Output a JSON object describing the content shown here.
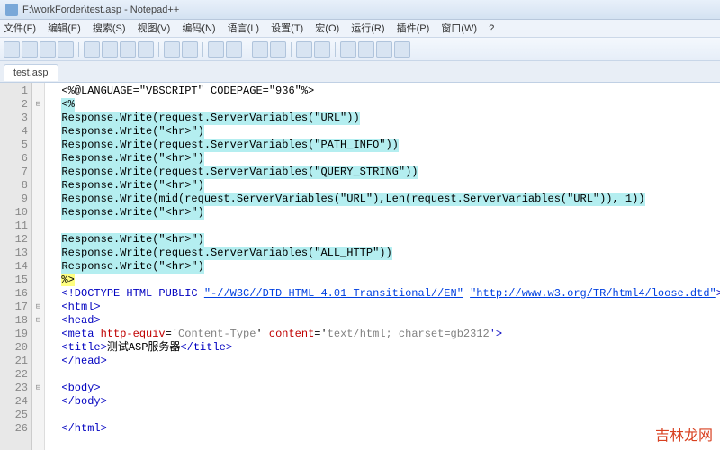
{
  "window": {
    "title": "F:\\workForder\\test.asp - Notepad++"
  },
  "menu": [
    "文件(F)",
    "编辑(E)",
    "搜索(S)",
    "视图(V)",
    "编码(N)",
    "语言(L)",
    "设置(T)",
    "宏(O)",
    "运行(R)",
    "插件(P)",
    "窗口(W)",
    "?"
  ],
  "tab": {
    "label": "test.asp"
  },
  "watermark": "吉林龙网",
  "code": {
    "lines": [
      {
        "n": "1",
        "fold": "",
        "hl": "none",
        "text": "<%@LANGUAGE=\"VBSCRIPT\" CODEPAGE=\"936\"%>"
      },
      {
        "n": "2",
        "fold": "⊟",
        "hl": "blue",
        "text": "<%"
      },
      {
        "n": "3",
        "fold": "",
        "hl": "blue",
        "text": "Response.Write(request.ServerVariables(\"URL\"))"
      },
      {
        "n": "4",
        "fold": "",
        "hl": "blue",
        "text": "Response.Write(\"<hr>\")"
      },
      {
        "n": "5",
        "fold": "",
        "hl": "blue",
        "text": "Response.Write(request.ServerVariables(\"PATH_INFO\"))"
      },
      {
        "n": "6",
        "fold": "",
        "hl": "blue",
        "text": "Response.Write(\"<hr>\")"
      },
      {
        "n": "7",
        "fold": "",
        "hl": "blue",
        "text": "Response.Write(request.ServerVariables(\"QUERY_STRING\"))"
      },
      {
        "n": "8",
        "fold": "",
        "hl": "blue",
        "text": "Response.Write(\"<hr>\")"
      },
      {
        "n": "9",
        "fold": "",
        "hl": "blue",
        "text": "Response.Write(mid(request.ServerVariables(\"URL\"),Len(request.ServerVariables(\"URL\")), 1))"
      },
      {
        "n": "10",
        "fold": "",
        "hl": "blue",
        "text": "Response.Write(\"<hr>\")"
      },
      {
        "n": "11",
        "fold": "",
        "hl": "blue",
        "text": ""
      },
      {
        "n": "12",
        "fold": "",
        "hl": "blue",
        "text": "Response.Write(\"<hr>\")"
      },
      {
        "n": "13",
        "fold": "",
        "hl": "blue",
        "text": "Response.Write(request.ServerVariables(\"ALL_HTTP\"))"
      },
      {
        "n": "14",
        "fold": "",
        "hl": "blue",
        "text": "Response.Write(\"<hr>\")"
      },
      {
        "n": "15",
        "fold": "",
        "hl": "yellow",
        "text": "%>"
      },
      {
        "n": "16",
        "fold": "",
        "hl": "none",
        "doctype": true,
        "pre": "<!DOCTYPE HTML PUBLIC ",
        "q1": "\"-//W3C//DTD HTML 4.01 Transitional//EN\"",
        "mid": " ",
        "q2": "\"http://www.w3.org/TR/html4/loose.dtd\"",
        "post": ">"
      },
      {
        "n": "17",
        "fold": "⊟",
        "hl": "none",
        "html": "<html>"
      },
      {
        "n": "18",
        "fold": "⊟",
        "hl": "none",
        "html": "<head>"
      },
      {
        "n": "19",
        "fold": "",
        "hl": "none",
        "meta": true,
        "t1": "<meta ",
        "a1": "http-equiv",
        "e1": "='",
        "v1": "Content-Type",
        "m1": "' ",
        "a2": "content",
        "e2": "='",
        "v2": "text/html; charset=gb2312",
        "t2": "'>"
      },
      {
        "n": "20",
        "fold": "",
        "hl": "none",
        "title": true,
        "open": "<title>",
        "txt": "测试ASP服务器",
        "close": "</title>"
      },
      {
        "n": "21",
        "fold": "",
        "hl": "none",
        "html": "</head>"
      },
      {
        "n": "22",
        "fold": "",
        "hl": "none",
        "text": ""
      },
      {
        "n": "23",
        "fold": "⊟",
        "hl": "none",
        "html": "<body>"
      },
      {
        "n": "24",
        "fold": "",
        "hl": "none",
        "html": "</body>"
      },
      {
        "n": "25",
        "fold": "",
        "hl": "none",
        "text": ""
      },
      {
        "n": "26",
        "fold": "",
        "hl": "none",
        "html": "</html>"
      }
    ]
  }
}
